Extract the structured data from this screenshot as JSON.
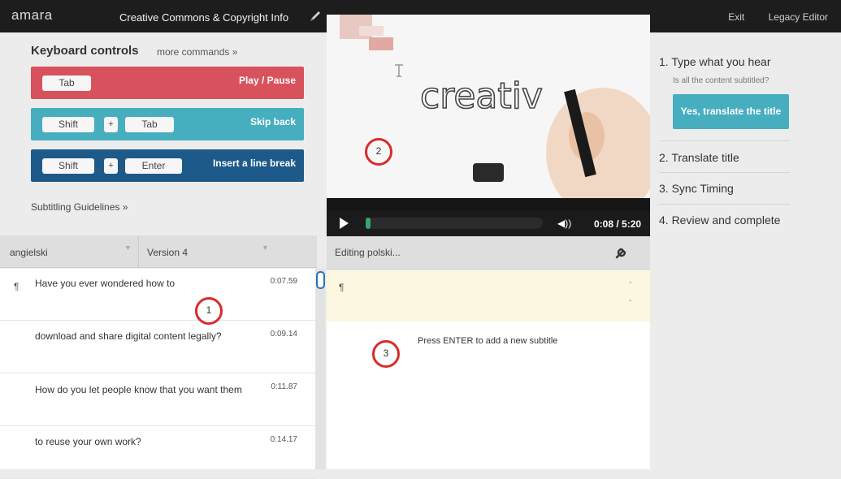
{
  "app": {
    "logo": "amara",
    "video_title": "Creative Commons & Copyright Info",
    "exit_label": "Exit",
    "legacy_label": "Legacy Editor"
  },
  "keyboard": {
    "title": "Keyboard controls",
    "more_label": "more commands »",
    "rows": [
      {
        "keys": [
          "Tab"
        ],
        "action": "Play / Pause"
      },
      {
        "keys": [
          "Shift",
          "Tab"
        ],
        "action": "Skip back"
      },
      {
        "keys": [
          "Shift",
          "Enter"
        ],
        "action": "Insert a line break"
      }
    ],
    "plus": "+",
    "guidelines_label": "Subtitling Guidelines »"
  },
  "reference": {
    "language": "angielski",
    "version": "Version 4",
    "subtitles": [
      {
        "text": "Have you ever wondered how to",
        "time": "0:07.59"
      },
      {
        "text": "download and share digital content legally?",
        "time": "0:09.14"
      },
      {
        "text": "How do you let people know that you want them",
        "time": "0:11.87"
      },
      {
        "text": "to reuse your own work?",
        "time": "0:14.17"
      }
    ],
    "pilcrow": "¶"
  },
  "player": {
    "frame_text": "creativ",
    "time": "0:08 / 5:20",
    "progress": 0.025
  },
  "editor": {
    "label": "Editing polski...",
    "pilcrow": "¶",
    "dot": "-",
    "hint": "Press ENTER to add a new subtitle"
  },
  "workflow": {
    "steps": [
      "1. Type what you hear",
      "2. Translate title",
      "3. Sync Timing",
      "4. Review and complete"
    ],
    "question": "Is all the content subtitled?",
    "button": "Yes, translate the title"
  },
  "markers": [
    "1",
    "2",
    "3"
  ],
  "colors": {
    "red_row": "#d7525c",
    "teal_row": "#46aebf",
    "navy_row": "#1d5a8a",
    "marker": "#d82b2b"
  }
}
